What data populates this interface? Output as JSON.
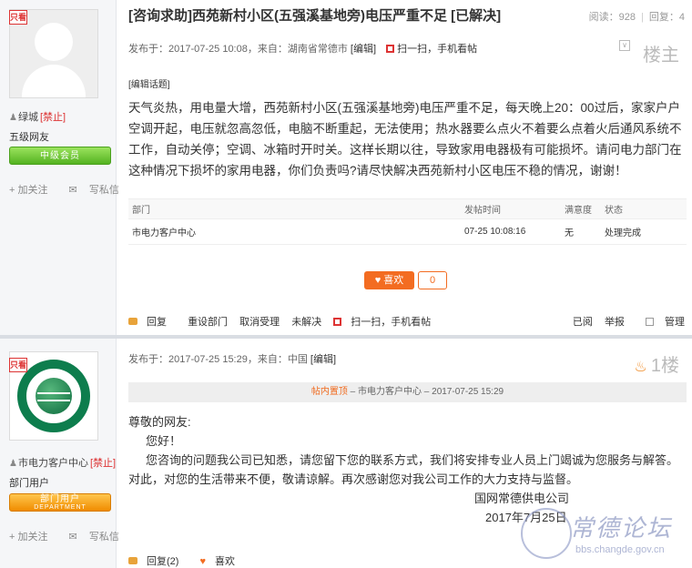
{
  "thread": {
    "title": "[咨询求助]西苑新村小区(五强溪基地旁)电压严重不足 [已解决]",
    "views_label": "阅读：928",
    "replies_label": "回复：4"
  },
  "post1": {
    "op_tag": "只看",
    "user_name": "绿城",
    "banned": "[禁止]",
    "rank": "五级网友",
    "level_badge": "中级会员",
    "follow": "加关注",
    "message": "写私信",
    "meta_posted": "发布于：2017-07-25 10:08，来自：湖南省常德市",
    "edit_link": "[编辑]",
    "qr_link": "扫一扫，手机看帖",
    "floor_label": "楼主",
    "edit_topic": "[编辑话题]",
    "content": "天气炎热，用电量大增，西苑新村小区(五强溪基地旁)电压严重不足，每天晚上20：00过后，家家户户空调开起，电压就忽高忽低，电脑不断重起，无法使用；热水器要么点火不着要么点着火后通风系统不工作，自动关停；空调、冰箱时开时关。这样长期以往，导致家用电器极有可能损坏。请问电力部门在这种情况下损坏的家用电器，你们负责吗?请尽快解决西苑新村小区电压不稳的情况，谢谢！",
    "table": {
      "headers": [
        "部门",
        "发帖时间",
        "满意度",
        "状态"
      ],
      "rows": [
        [
          "市电力客户中心",
          "07-25 10:08:16",
          "无",
          "处理完成"
        ]
      ]
    },
    "like_label": "喜欢",
    "like_count": "0",
    "foot": {
      "reply": "回复",
      "reset_dept": "重设部门",
      "cancel_accept": "取消受理",
      "unresolved": "未解决",
      "qr": "扫一扫，手机看帖",
      "read": "已阅",
      "report": "举报",
      "manage": "管理"
    }
  },
  "post2": {
    "op_tag": "只看",
    "user_name": "市电力客户中心",
    "banned": "[禁止]",
    "rank": "部门用户",
    "level_badge": "部门用户",
    "level_badge_sub": "DEPARTMENT",
    "follow": "加关注",
    "message": "写私信",
    "meta_posted": "发布于：2017-07-25 15:29，来自：中国",
    "edit_link": "[编辑]",
    "floor_label": "1楼",
    "sticky": {
      "tag": "帖内置顶",
      "text": " – 市电力客户中心 – 2017-07-25 15:29"
    },
    "lines": {
      "greeting": "尊敬的网友:",
      "hello": "您好！",
      "body1": "您咨询的问题我公司已知悉，请您留下您的联系方式，我们将安排专业人员上门竭诚为您服务与解答。",
      "body2": "对此，对您的生活带来不便，敬请谅解。再次感谢您对我公司工作的大力支持与监督。",
      "signature": "国网常德供电公司",
      "date": "2017年7月25日"
    },
    "foot": {
      "reply": "回复(2)",
      "like": "喜欢"
    }
  },
  "watermark": {
    "title": "常德论坛",
    "url": "bbs.changde.gov.cn"
  },
  "colors": {
    "accent_orange": "#f36c21",
    "banned_red": "#dd3333",
    "sgcc_green": "#0d7d4d"
  }
}
